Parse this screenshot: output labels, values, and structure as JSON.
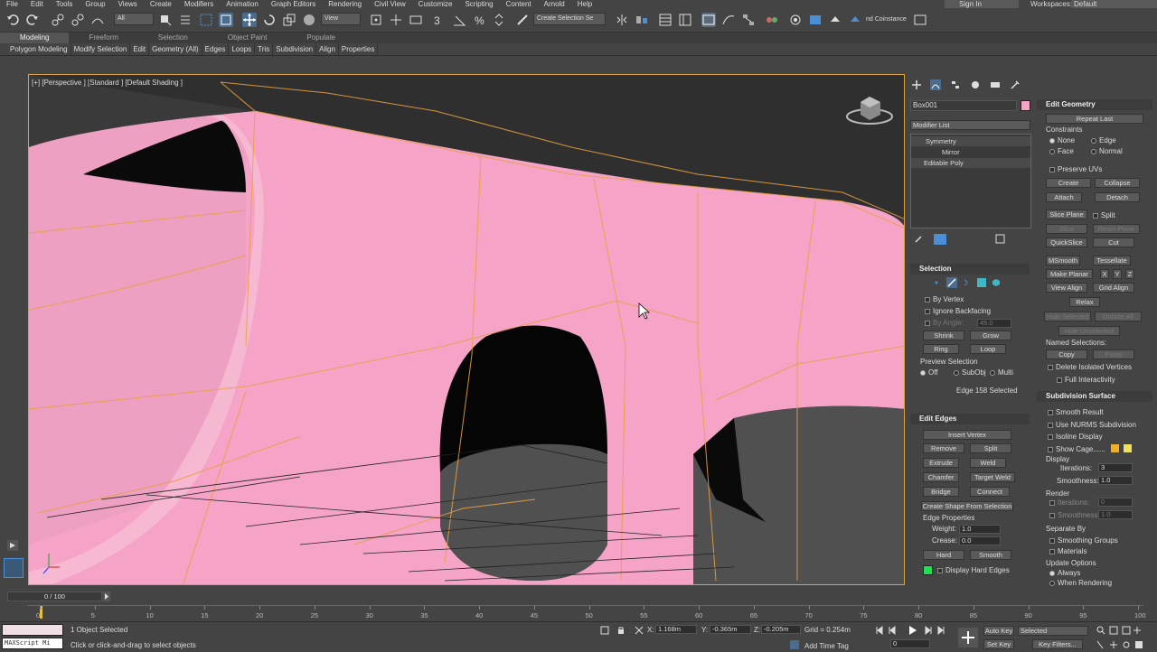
{
  "menu": [
    "File",
    "Edit",
    "Tools",
    "Group",
    "Views",
    "Create",
    "Modifiers",
    "Animation",
    "Graph Editors",
    "Rendering",
    "Civil View",
    "Customize",
    "Scripting",
    "Content",
    "Arnold",
    "Help"
  ],
  "signin": "Sign In",
  "workspaces_label": "Workspaces:",
  "workspace_value": "Default",
  "toolbar": {
    "filter_value": "All",
    "view_value": "View",
    "selection_set": "Create Selection Se",
    "coinstance": "nd Coinstance"
  },
  "ribbon": {
    "tabs": [
      "Modeling",
      "Freeform",
      "Selection",
      "Object Paint",
      "Populate"
    ],
    "sub": [
      "Polygon Modeling",
      "Modify Selection",
      "Edit",
      "Geometry (All)",
      "Edges",
      "Loops",
      "Tris",
      "Subdivision",
      "Align",
      "Properties"
    ]
  },
  "viewport": {
    "label": "[+] [Perspective ] [Standard ] [Default Shading ]"
  },
  "command_panel": {
    "object_name": "Box001",
    "object_color": "#f5a3c7",
    "modifier_list": "Modifier List",
    "stack": [
      "Symmetry",
      "Mirror",
      "Editable Poly"
    ],
    "selection": {
      "title": "Selection",
      "by_vertex": "By Vertex",
      "ignore_backfacing": "Ignore Backfacing",
      "by_angle": "By Angle:",
      "angle_value": "45.0",
      "shrink": "Shrink",
      "grow": "Grow",
      "ring": "Ring",
      "loop": "Loop",
      "preview": "Preview Selection",
      "off": "Off",
      "subobj": "SubObj",
      "multi": "Multi",
      "status": "Edge 158 Selected"
    },
    "edit_edges": {
      "title": "Edit Edges",
      "insert_vertex": "Insert Vertex",
      "remove": "Remove",
      "split": "Split",
      "extrude": "Extrude",
      "weld": "Weld",
      "chamfer": "Chamfer",
      "target_weld": "Target Weld",
      "bridge": "Bridge",
      "connect": "Connect",
      "create_shape": "Create Shape From Selection",
      "edge_props": "Edge Properties",
      "weight": "Weight:",
      "weight_value": "1.0",
      "crease": "Crease:",
      "crease_value": "0.0",
      "hard": "Hard",
      "smooth": "Smooth",
      "display_hard": "Display Hard Edges"
    }
  },
  "edit_geometry": {
    "title": "Edit Geometry",
    "repeat_last": "Repeat Last",
    "constraints": "Constraints",
    "none": "None",
    "edge": "Edge",
    "face": "Face",
    "normal": "Normal",
    "preserve_uvs": "Preserve UVs",
    "create": "Create",
    "collapse": "Collapse",
    "attach": "Attach",
    "detach": "Detach",
    "slice_plane": "Slice Plane",
    "split": "Split",
    "slice": "Slice",
    "reset_plane": "Reset Plane",
    "quickslice": "QuickSlice",
    "cut": "Cut",
    "msmooth": "MSmooth",
    "tessellate": "Tessellate",
    "make_planar": "Make Planar",
    "x": "X",
    "y": "Y",
    "z": "Z",
    "view_align": "View Align",
    "grid_align": "Grid Align",
    "relax": "Relax",
    "hide_selected": "Hide Selected",
    "unhide_all": "Unhide All",
    "hide_unselected": "Hide Unselected",
    "named_selections": "Named Selections:",
    "copy": "Copy",
    "paste": "Paste",
    "delete_isolated": "Delete Isolated Vertices",
    "full_interactivity": "Full Interactivity"
  },
  "subdivision_surface": {
    "title": "Subdivision Surface",
    "smooth_result": "Smooth Result",
    "use_nurms": "Use NURMS Subdivision",
    "isoline": "Isoline Display",
    "show_cage": "Show Cage......",
    "display": "Display",
    "iterations": "Iterations:",
    "iterations_value": "3",
    "smoothness": "Smoothness:",
    "smoothness_value": "1.0",
    "render": "Render",
    "r_iterations": "Iterations:",
    "r_iterations_value": "0",
    "r_smoothness": "Smoothness:",
    "r_smoothness_value": "1.0",
    "separate_by": "Separate By",
    "smoothing_groups": "Smoothing Groups",
    "materials": "Materials",
    "update_options": "Update Options",
    "always": "Always",
    "when_rendering": "When Rendering"
  },
  "timeline": {
    "frame": "0 / 100",
    "ticks": [
      "0",
      "5",
      "10",
      "15",
      "20",
      "25",
      "30",
      "35",
      "40",
      "45",
      "50",
      "55",
      "60",
      "65",
      "70",
      "75",
      "80",
      "85",
      "90",
      "95",
      "100"
    ]
  },
  "status": {
    "maxscript": "MAXScript Mi",
    "selected": "1 Object Selected",
    "hint": "Click or click-and-drag to select objects",
    "x_label": "X:",
    "x": "1.168m",
    "y_label": "Y:",
    "y": "-0.365m",
    "z_label": "Z:",
    "z": "-0.205m",
    "grid": "Grid = 0.254m",
    "add_time_tag": "Add Time Tag",
    "auto_key": "Auto Key",
    "selected_dd": "Selected",
    "set_key": "Set Key",
    "key_filters": "Key Filters...",
    "frame_value": "0"
  },
  "colors": {
    "mesh_pink": "#f5a3c7",
    "cage_orange": "#e8a040",
    "accent_blue": "#4a8fd6",
    "active_border": "#d9a23a"
  }
}
